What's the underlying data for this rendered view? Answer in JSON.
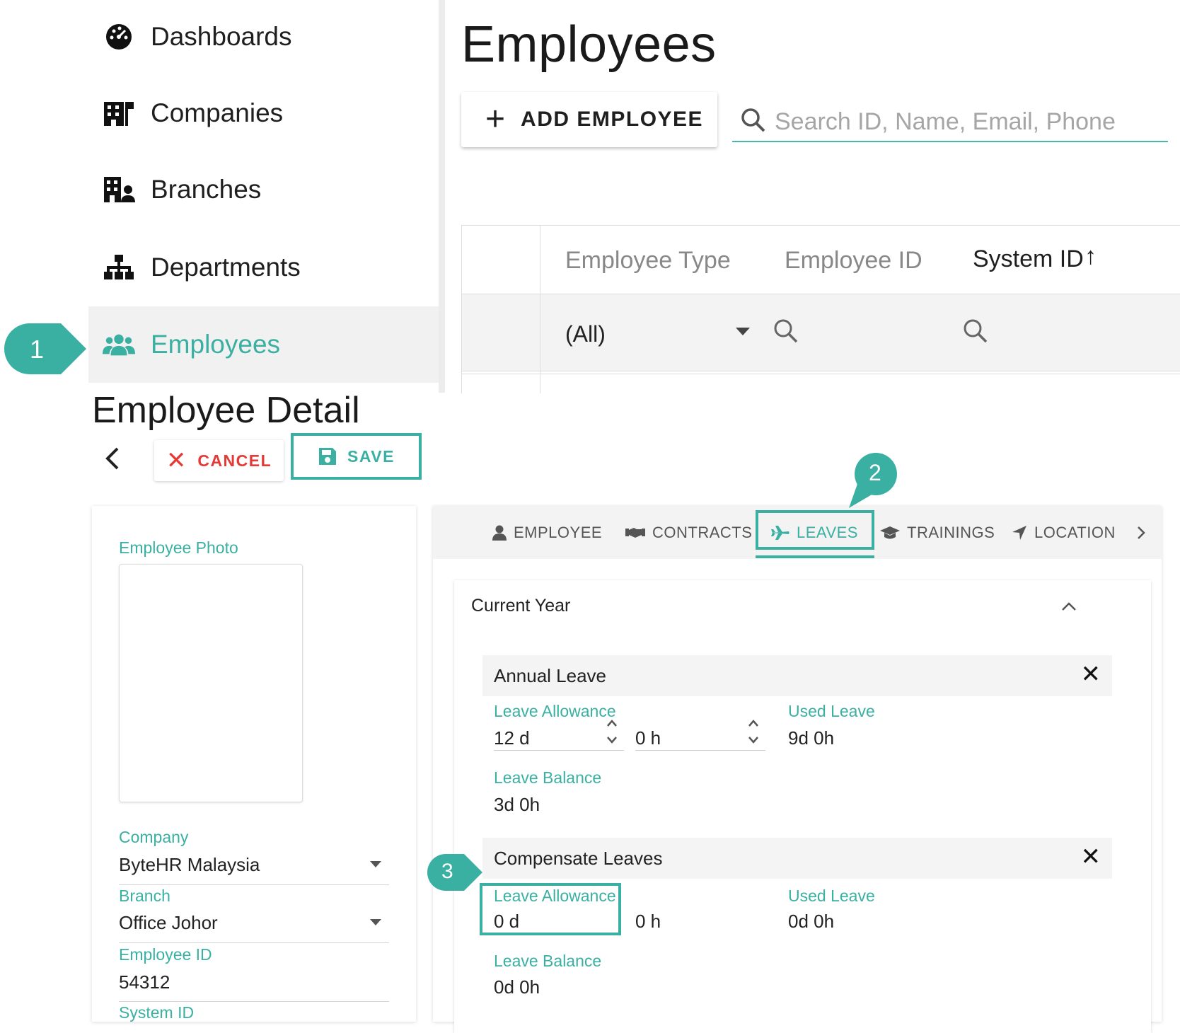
{
  "sidebar": {
    "items": [
      {
        "label": "Dashboards",
        "icon": "dashboard-gauge-icon"
      },
      {
        "label": "Companies",
        "icon": "companies-building-icon"
      },
      {
        "label": "Branches",
        "icon": "branches-building-icon"
      },
      {
        "label": "Departments",
        "icon": "departments-sitemap-icon"
      },
      {
        "label": "Employees",
        "icon": "employees-users-icon",
        "active": true
      }
    ]
  },
  "employees_page": {
    "title": "Employees",
    "add_button_label": "ADD EMPLOYEE",
    "search_placeholder": "Search ID, Name, Email, Phone",
    "columns": [
      "Employee Type",
      "Employee ID",
      "System ID"
    ],
    "sort_indicator": "↑",
    "filter_type_value": "(All)"
  },
  "detail": {
    "title": "Employee Detail",
    "cancel_label": "CANCEL",
    "save_label": "SAVE",
    "fields": {
      "photo_label": "Employee Photo",
      "company_label": "Company",
      "company_value": "ByteHR Malaysia",
      "branch_label": "Branch",
      "branch_value": "Office Johor",
      "employee_id_label": "Employee ID",
      "employee_id_value": "54312",
      "system_id_label": "System ID"
    },
    "tabs": [
      "EMPLOYEE",
      "CONTRACTS",
      "LEAVES",
      "TRAININGS",
      "LOCATION"
    ],
    "active_tab": "LEAVES",
    "section_title": "Current Year",
    "leaves": [
      {
        "name": "Annual Leave",
        "allowance_label": "Leave Allowance",
        "allowance_days": "12 d",
        "allowance_hours": "0 h",
        "used_label": "Used Leave",
        "used_value": "9d 0h",
        "balance_label": "Leave Balance",
        "balance_value": "3d 0h"
      },
      {
        "name": "Compensate Leaves",
        "allowance_label": "Leave Allowance",
        "allowance_days": "0 d",
        "allowance_hours": "0 h",
        "used_label": "Used Leave",
        "used_value": "0d 0h",
        "balance_label": "Leave Balance",
        "balance_value": "0d 0h"
      }
    ]
  },
  "callouts": [
    "1",
    "2",
    "3"
  ],
  "colors": {
    "accent": "#3ab0a2",
    "cancel": "#e53935"
  }
}
